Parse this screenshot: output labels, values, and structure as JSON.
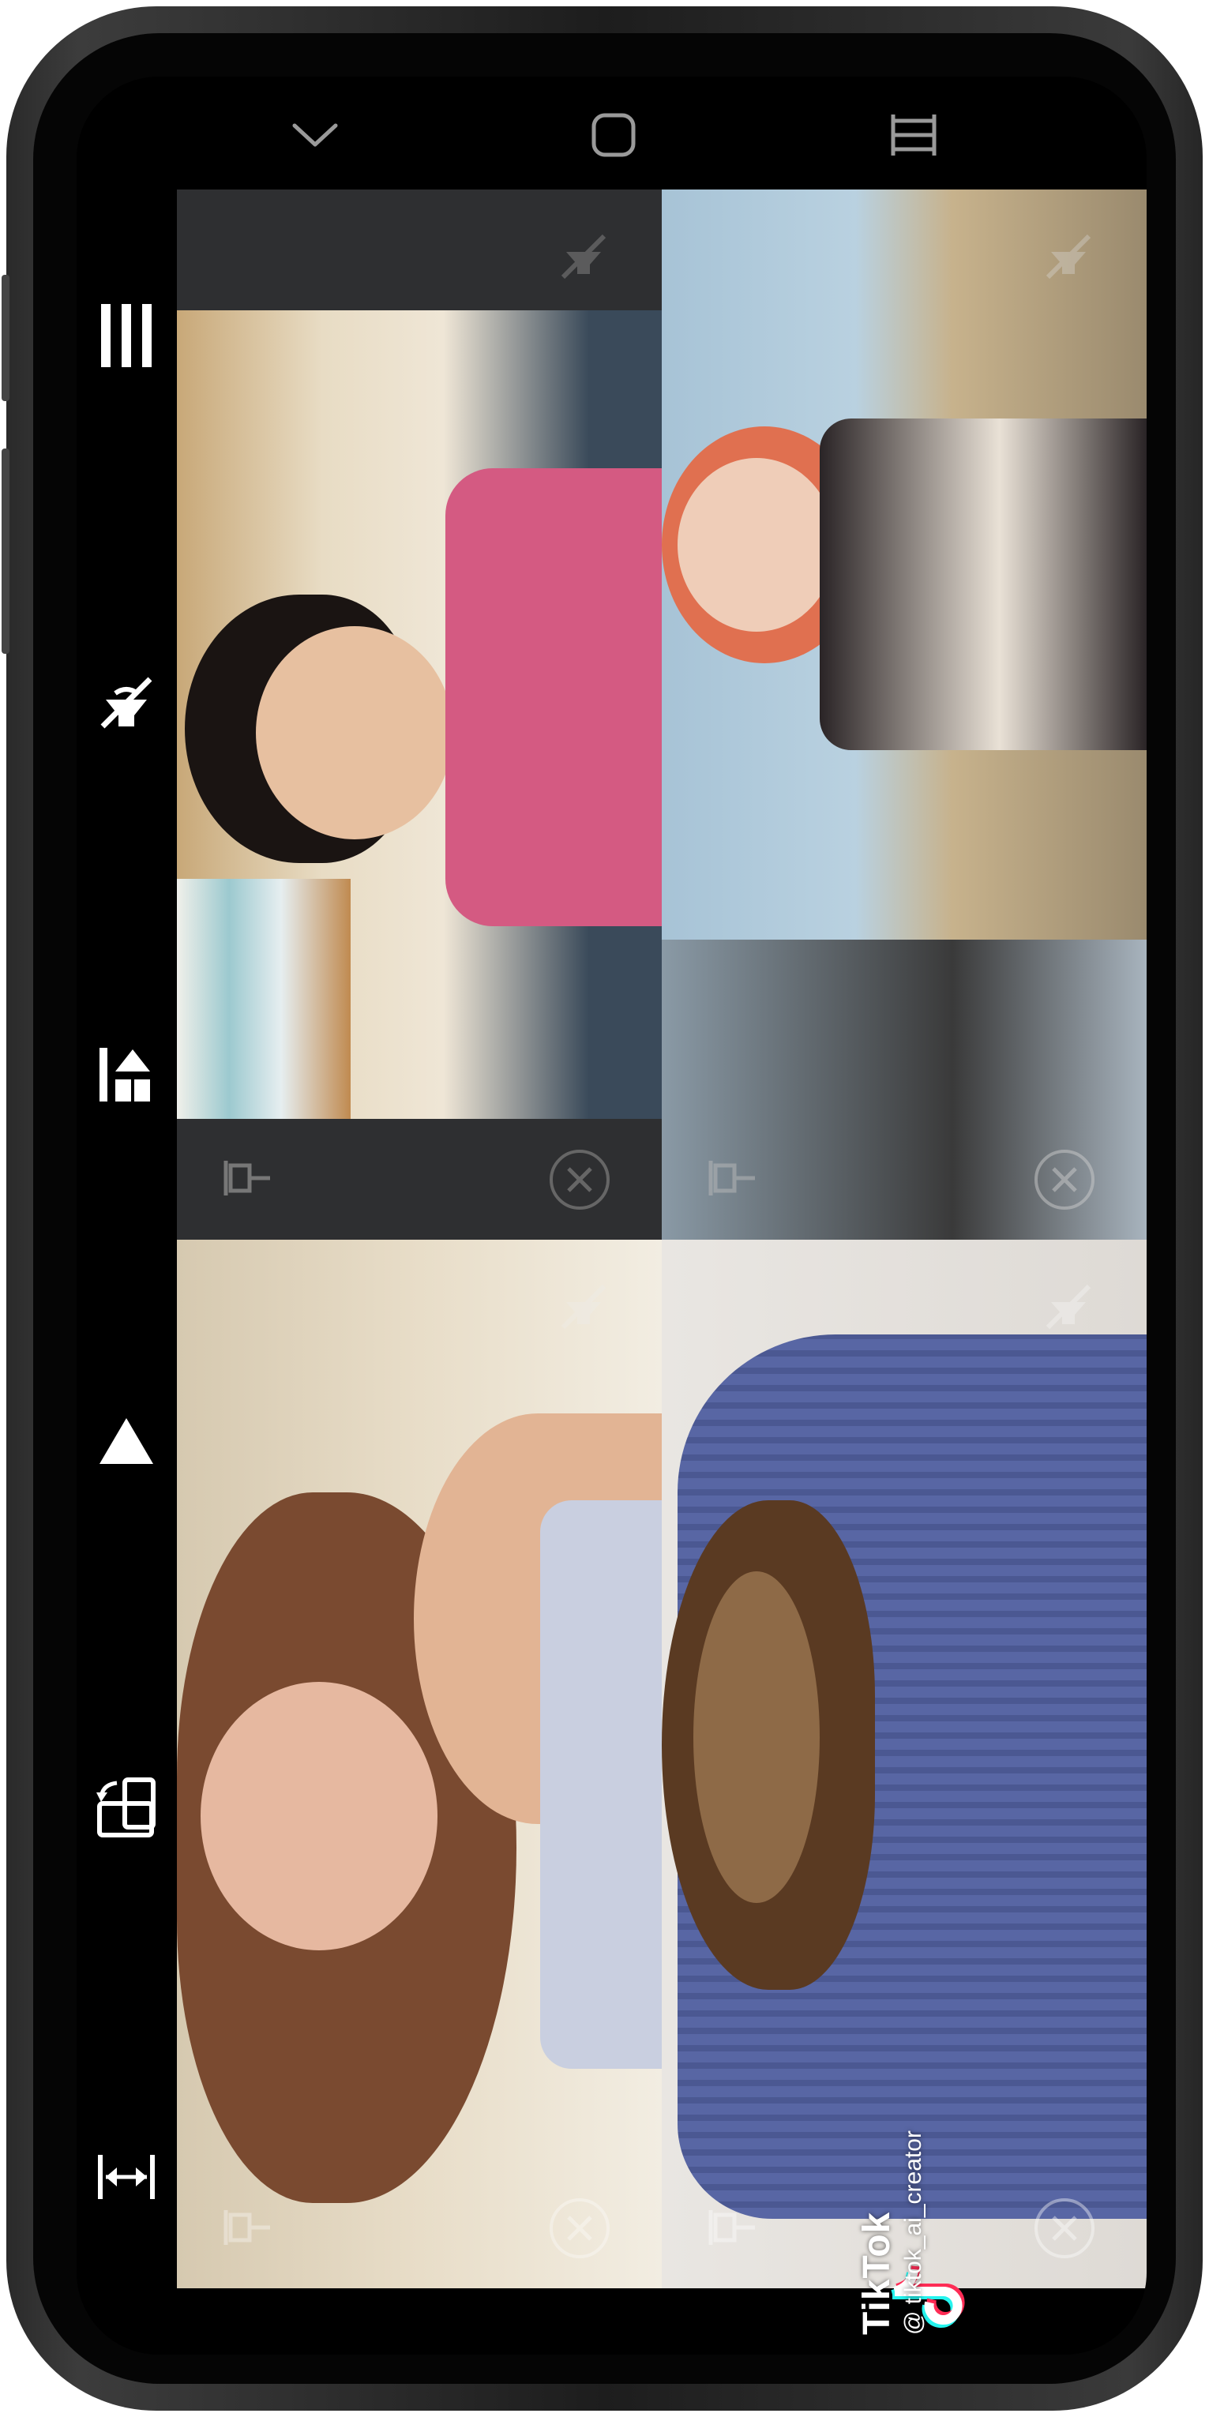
{
  "device": {
    "frame_color": "#2a2a2a",
    "screen_color": "#000000"
  },
  "navbar": {
    "items": [
      {
        "icon": "chevron-down-icon"
      },
      {
        "icon": "home-square-icon"
      },
      {
        "icon": "recent-apps-icon"
      }
    ]
  },
  "toolbar": {
    "items": [
      {
        "icon": "menu-bars-icon"
      },
      {
        "icon": "mute-off-icon"
      },
      {
        "icon": "grid-layout-icon"
      },
      {
        "icon": "triangle-up-icon"
      },
      {
        "icon": "rotate-screen-icon"
      },
      {
        "icon": "stretch-horizontal-icon"
      }
    ]
  },
  "tiles": [
    {
      "name": "top-left",
      "controls": [
        "mute-icon",
        "pin-icon",
        "close-icon"
      ],
      "accent": "#d45a82"
    },
    {
      "name": "top-right",
      "controls": [
        "mute-icon",
        "pin-icon",
        "close-icon"
      ],
      "accent": "#e07050"
    },
    {
      "name": "bottom-left",
      "controls": [
        "mute-icon",
        "pin-icon",
        "close-icon"
      ],
      "accent": "#8a5a3a"
    },
    {
      "name": "bottom-right",
      "controls": [
        "mute-icon",
        "pin-icon",
        "close-icon"
      ],
      "accent": "#5a6aa8"
    }
  ],
  "watermark": {
    "brand": "TikTok",
    "handle": "@ tiktok_ai_creator"
  }
}
